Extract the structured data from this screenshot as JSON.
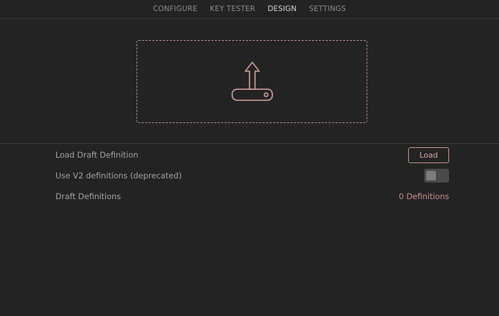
{
  "nav": {
    "tabs": [
      {
        "label": "CONFIGURE",
        "active": false
      },
      {
        "label": "KEY TESTER",
        "active": false
      },
      {
        "label": "DESIGN",
        "active": true
      },
      {
        "label": "SETTINGS",
        "active": false
      }
    ]
  },
  "dropzone": {
    "icon": "upload-tray-icon"
  },
  "settings": {
    "load_label": "Load Draft Definition",
    "load_button": "Load",
    "v2_label": "Use V2 definitions (deprecated)",
    "v2_enabled": false,
    "draft_label": "Draft Definitions",
    "draft_count": "0 Definitions"
  },
  "colors": {
    "background": "#232323",
    "accent": "#c99a97",
    "divider": "#3a3a3a"
  }
}
